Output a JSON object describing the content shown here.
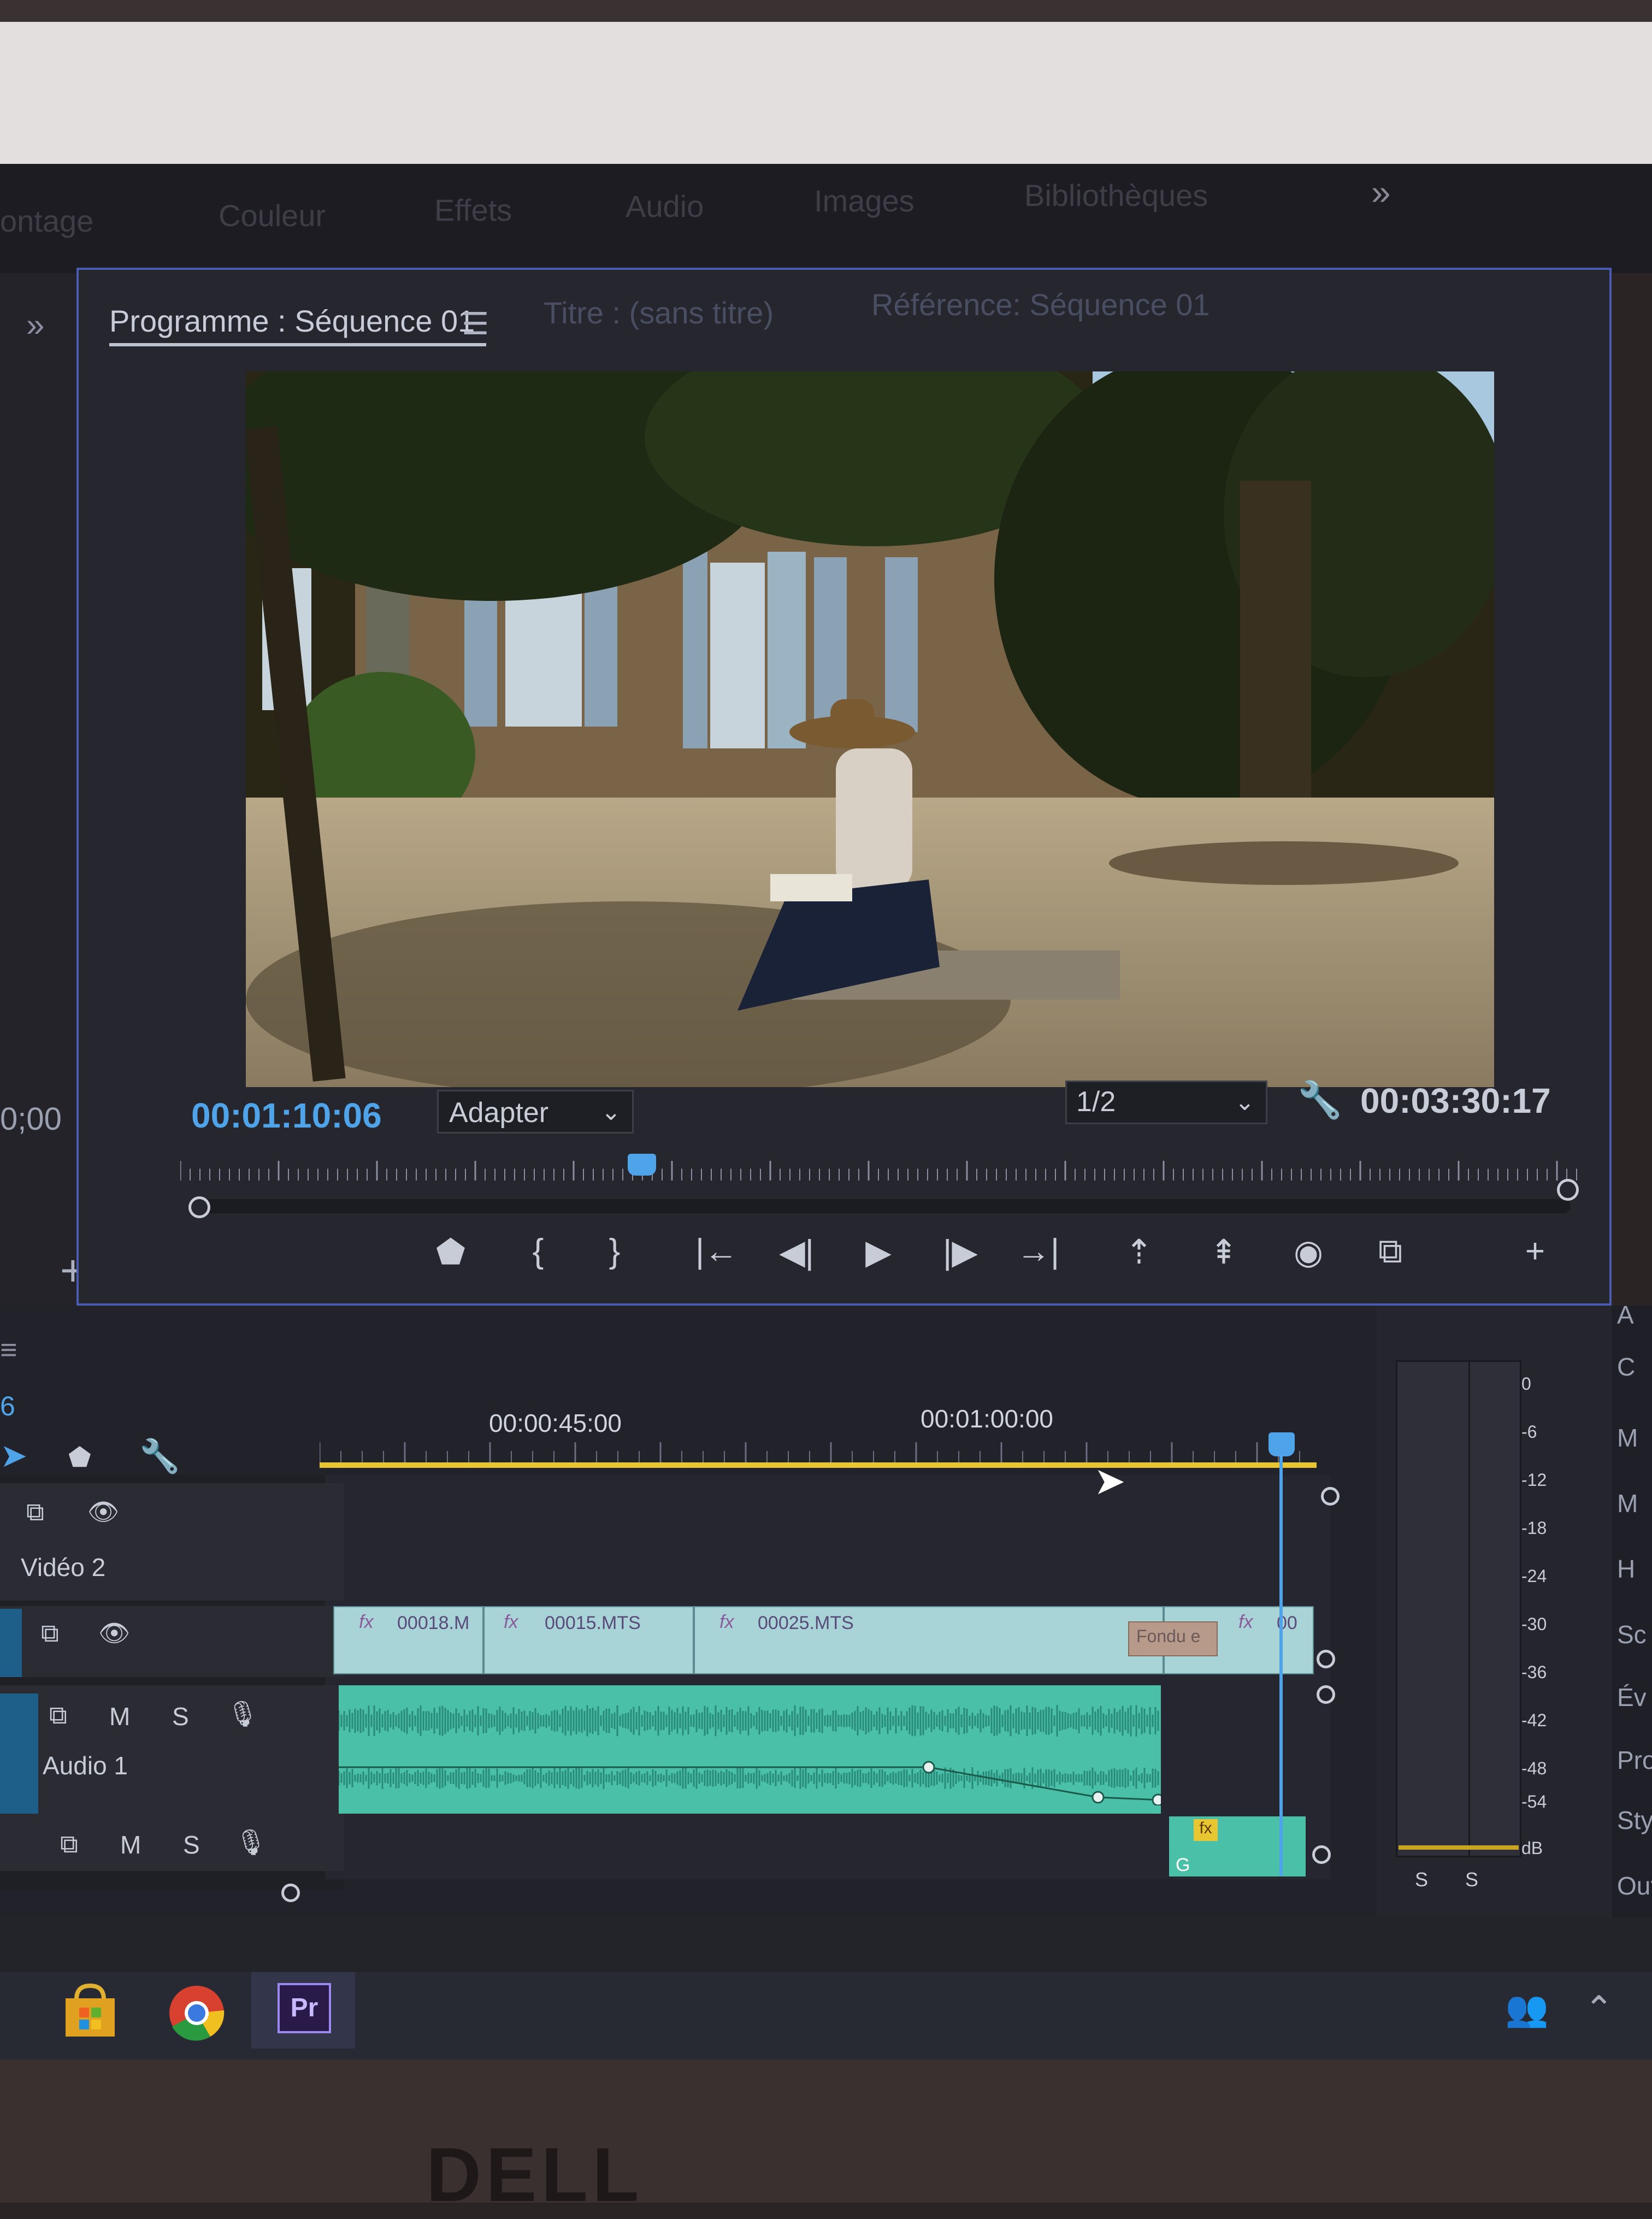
{
  "workspaces": {
    "tabs": [
      "ontage",
      "Couleur",
      "Effets",
      "Audio",
      "Images",
      "Bibliothèques"
    ],
    "more": "»"
  },
  "left_panel": {
    "chevron": "»",
    "time": "0;00",
    "add": "+"
  },
  "program_monitor": {
    "tab_label": "Programme : Séquence 01",
    "menu_icon": "☰",
    "title_tab": "Titre : (sans titre)",
    "reference_tab": "Référence: Séquence 01",
    "current_time": "00:01:10:06",
    "fit": "Adapter",
    "resolution": "1/2",
    "duration": "00:03:30:17",
    "playhead_fraction": 0.33,
    "transport": {
      "marker": "⬟",
      "mark_in": "{",
      "mark_out": "}",
      "go_to_in": "|←",
      "step_back": "◀|",
      "play": "▶",
      "step_forward": "|▶",
      "go_to_out": "→|",
      "lift": "⇡",
      "extract": "⇞",
      "export_frame": "◉",
      "comparison": "⧉",
      "add": "+"
    }
  },
  "timeline": {
    "menu_icon": "≡",
    "time_stub": "6",
    "ruler_labels": [
      "00:00:45:00",
      "00:01:00:00"
    ],
    "tracks": {
      "v2": {
        "label": "Vidéo 2"
      },
      "v1": {
        "label": ""
      },
      "a1": {
        "label": "Audio 1",
        "mute": "M",
        "solo": "S"
      },
      "a2": {
        "mute": "M",
        "solo": "S"
      }
    },
    "clips": [
      {
        "fx": "fx",
        "name": "00018.M"
      },
      {
        "fx": "fx",
        "name": "00015.MTS"
      },
      {
        "fx": "fx",
        "name": "00025.MTS"
      },
      {
        "fx": "fx",
        "name": "00"
      }
    ],
    "transition": "Fondu e",
    "audio_fx": "fx",
    "audio_g": "G"
  },
  "audio_meter": {
    "db_labels": [
      "0",
      "-6",
      "-12",
      "-18",
      "-24",
      "-30",
      "-36",
      "-42",
      "-48",
      "-54",
      "dB"
    ],
    "solo_left": "S",
    "solo_right": "S"
  },
  "right_panel": {
    "items": [
      "A",
      "C",
      "M",
      "M",
      "H",
      "Sc",
      "Év",
      "Pro",
      "Sty",
      "Out"
    ]
  },
  "taskbar": {
    "premiere": "Pr"
  },
  "device": {
    "brand": "DELL"
  },
  "colors": {
    "accent_blue": "#4fa3e8",
    "work_area_yellow": "#e8c632",
    "video_clip": "#a8d4d8",
    "audio_clip": "#4ac0a8",
    "panel_focus_border": "#4a5bb0"
  }
}
